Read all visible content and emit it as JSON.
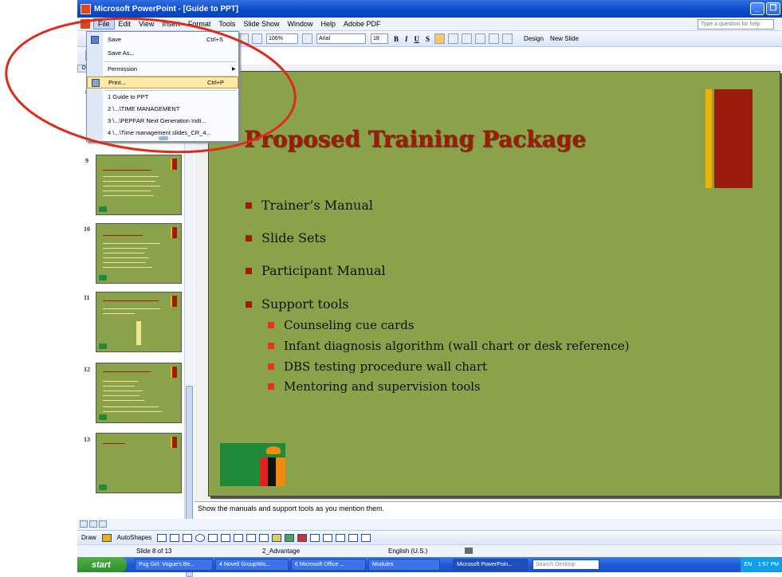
{
  "window": {
    "title": "Microsoft PowerPoint - [Guide to PPT]"
  },
  "menubar": {
    "items": [
      "File",
      "Edit",
      "View",
      "Insert",
      "Format",
      "Tools",
      "Slide Show",
      "Window",
      "Help",
      "Adobe PDF"
    ],
    "help_placeholder": "Type a question for help"
  },
  "toolbar": {
    "zoom": "106%",
    "font": "Arial",
    "font_size": "18",
    "design_label": "Design",
    "new_slide_label": "New Slide",
    "bold": "B",
    "italic": "I",
    "underline": "U",
    "shadow": "S"
  },
  "file_menu": {
    "save": {
      "label": "Save",
      "shortcut": "Ctrl+S"
    },
    "save_as": {
      "label": "Save As..."
    },
    "permission": {
      "label": "Permission"
    },
    "print": {
      "label": "Print...",
      "shortcut": "Ctrl+P"
    },
    "recent": [
      "1 Guide to PPT",
      "2 \\...\\TIME MANAGEMENT",
      "3 \\...\\PEPFAR Next Generation Indi...",
      "4 \\...\\Time management slides_CR_4..."
    ]
  },
  "slide_panel": {
    "thumbnails": [
      {
        "number": "8"
      },
      {
        "number": "9"
      },
      {
        "number": "10"
      },
      {
        "number": "11"
      },
      {
        "number": "12"
      },
      {
        "number": "13"
      }
    ]
  },
  "slide": {
    "title": "Proposed Training Package",
    "bullets": [
      {
        "level": 1,
        "text": "Trainer’s Manual"
      },
      {
        "level": 1,
        "text": "Slide Sets"
      },
      {
        "level": 1,
        "text": "Participant Manual"
      },
      {
        "level": 1,
        "text": "Support tools"
      },
      {
        "level": 2,
        "text": "Counseling cue cards"
      },
      {
        "level": 2,
        "text": "Infant diagnosis algorithm (wall chart or desk reference)"
      },
      {
        "level": 2,
        "text": "DBS testing procedure wall chart"
      },
      {
        "level": 2,
        "text": "Mentoring and supervision tools"
      }
    ],
    "colors": {
      "background": "#8aa24a",
      "title": "#9b1c0a",
      "accent_gold": "#f2b200",
      "accent_red": "#9b1c0a"
    }
  },
  "notes": {
    "text": "Show the manuals and support tools as you mention them."
  },
  "drawbar": {
    "draw_label": "Draw",
    "autoshapes_label": "AutoShapes"
  },
  "statusbar": {
    "slide_info": "Slide 8 of 13",
    "design": "2_Advantage",
    "language": "English (U.S.)"
  },
  "taskbar": {
    "start_label": "start",
    "tasks": [
      "Pug Girl: Vogue's Be...",
      "4 Novell GroupWis...",
      "6 Microsoft Office ...",
      "Modules",
      "Microsoft PowerPoin..."
    ],
    "search_placeholder": "Search Desktop",
    "tray": "EN",
    "clock": "1:57 PM"
  }
}
